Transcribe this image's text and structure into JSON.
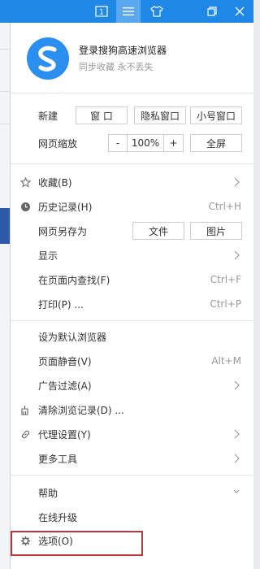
{
  "colors": {
    "titlebar": "#1f87e5",
    "highlight_border": "#c0353b",
    "logo": "#2a8ff0"
  },
  "titlebar": {
    "icons": [
      "badge-1-icon",
      "menu-icon",
      "shirt-icon",
      "restore-icon",
      "close-icon"
    ],
    "badge_number": "1"
  },
  "account": {
    "title": "登录搜狗高速浏览器",
    "subtitle": "同步收藏 永不丢失"
  },
  "new_row": {
    "label": "新建",
    "buttons": [
      "窗 口",
      "隐私窗口",
      "小号窗口"
    ]
  },
  "zoom_row": {
    "label": "网页缩放",
    "minus": "-",
    "value": "100%",
    "plus": "+",
    "fullscreen": "全屏"
  },
  "menu_items": {
    "favorites": {
      "label": "收藏(B)"
    },
    "history": {
      "label": "历史记录(H)",
      "shortcut": "Ctrl+H"
    },
    "save_as": {
      "label": "网页另存为",
      "btn_file": "文件",
      "btn_image": "图片"
    },
    "display": {
      "label": "显示"
    },
    "find": {
      "label": "在页面内查找(F)",
      "shortcut": "Ctrl+F"
    },
    "print": {
      "label": "打印(P) ...",
      "shortcut": "Ctrl+P"
    },
    "default_browser": {
      "label": "设为默认浏览器"
    },
    "mute": {
      "label": "页面静音(V)",
      "shortcut": "Alt+M"
    },
    "adblock": {
      "label": "广告过滤(A)"
    },
    "clear": {
      "label": "清除浏览记录(D) ..."
    },
    "proxy": {
      "label": "代理设置(Y)"
    },
    "more_tools": {
      "label": "更多工具"
    },
    "help": {
      "label": "帮助"
    },
    "upgrade": {
      "label": "在线升级"
    },
    "options": {
      "label": "选项(O)"
    }
  }
}
